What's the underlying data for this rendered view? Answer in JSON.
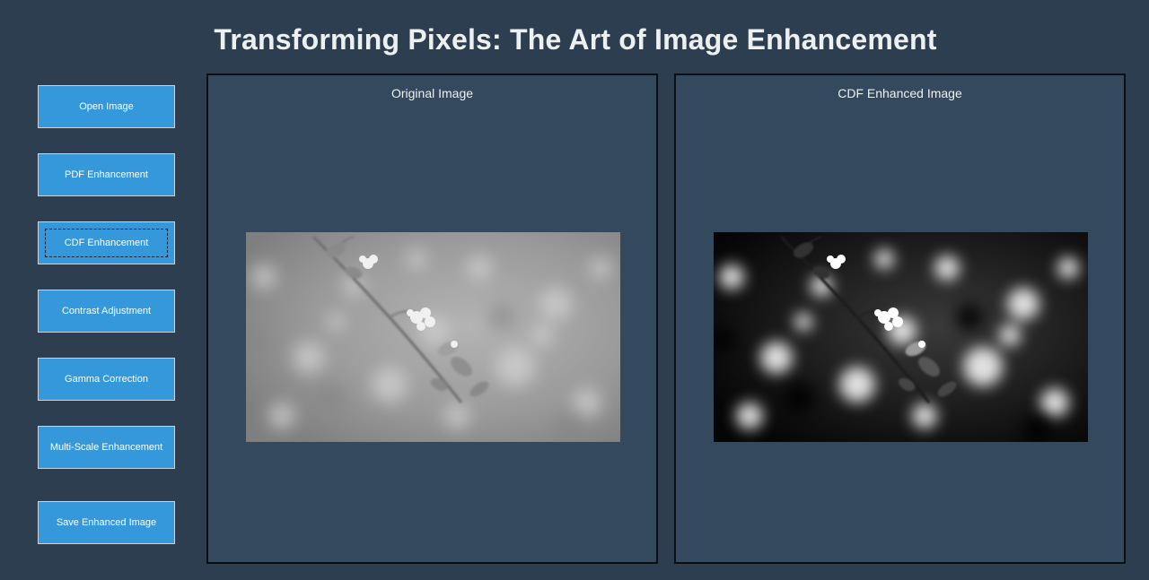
{
  "app": {
    "title": "Transforming Pixels: The Art of Image Enhancement"
  },
  "sidebar": {
    "buttons": [
      {
        "label": "Open Image"
      },
      {
        "label": "PDF Enhancement"
      },
      {
        "label": "CDF Enhancement",
        "focused": true
      },
      {
        "label": "Contrast Adjustment"
      },
      {
        "label": "Gamma Correction"
      },
      {
        "label": "Multi-Scale Enhancement"
      },
      {
        "label": "Save Enhanced Image"
      }
    ]
  },
  "panels": {
    "original": {
      "title": "Original Image"
    },
    "enhanced": {
      "title": "CDF Enhanced Image"
    }
  },
  "colors": {
    "background": "#2c3e50",
    "panel": "#34495e",
    "button": "#3498db",
    "text": "#ecf0f1"
  }
}
